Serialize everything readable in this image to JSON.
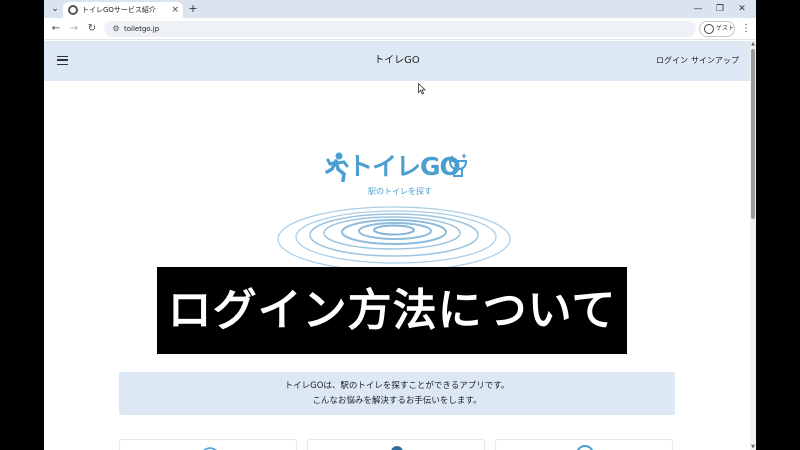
{
  "browser": {
    "tab_title": "トイレGOサービス紹介",
    "tab_close": "×",
    "new_tab": "+",
    "tab_search": "⌄",
    "minimize": "—",
    "restore": "❐",
    "close_window": "✕",
    "back": "←",
    "forward": "→",
    "reload": "↻",
    "site_info": "⚙",
    "url": "toiletgo.jp",
    "guest_label": "ゲスト",
    "menu": "⋮"
  },
  "header": {
    "title": "トイレGO",
    "login": "ログイン",
    "signup": "サインアップ"
  },
  "hero": {
    "logo_text": "トイレGO",
    "logo_tagline": "駅のトイレを探す"
  },
  "caption": "ログイン方法について",
  "intro": {
    "line1": "トイレGOは、駅のトイレを探すことができるアプリです。",
    "line2": "こんなお悩みを解決するお手伝いをします。"
  },
  "scrollbar": {
    "up": "▲",
    "down": "▼"
  },
  "colors": {
    "header_bg": "#dce8f4",
    "brand": "#4a9ed0",
    "info_bg": "#dce8f4"
  }
}
